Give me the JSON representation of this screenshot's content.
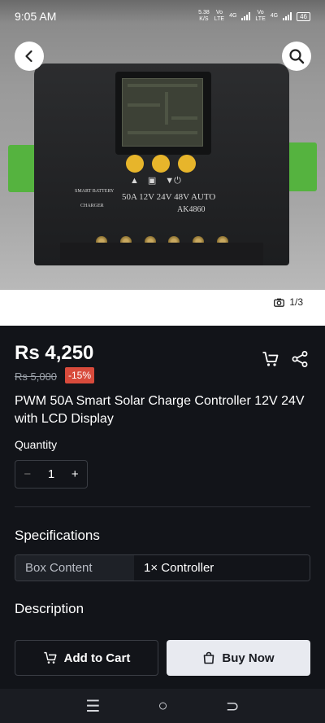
{
  "status_bar": {
    "time": "9:05 AM",
    "speed_value": "5.38",
    "speed_unit": "K/S",
    "sim1_top": "Vo",
    "sim1_bottom": "LTE",
    "sim1_net": "4G",
    "sim2_top": "Vo",
    "sim2_bottom": "LTE",
    "sim2_net": "4G",
    "battery": "46"
  },
  "product_image": {
    "device_label_left_1": "SMART BATTERY",
    "device_label_left_2": "CHARGER",
    "device_label_main": "50A 12V 24V 48V AUTO",
    "device_model": "AK4860",
    "counter": "1/3"
  },
  "product": {
    "price": "Rs 4,250",
    "original_price": "Rs 5,000",
    "discount_badge": "-15%",
    "title": "PWM 50A Smart Solar Charge Controller 12V 24V with LCD Display",
    "quantity_label": "Quantity",
    "quantity_value": "1",
    "minus_symbol": "−",
    "plus_symbol": "+"
  },
  "specifications": {
    "heading": "Specifications",
    "rows": [
      {
        "key": "Box Content",
        "value": "1× Controller"
      }
    ]
  },
  "description": {
    "heading": "Description"
  },
  "actions": {
    "add_to_cart": "Add to Cart",
    "buy_now": "Buy Now"
  },
  "system_nav": {
    "menu_glyph": "☰",
    "home_glyph": "○",
    "back_glyph": "⊃"
  },
  "colors": {
    "background": "#121419",
    "discount": "#d84b3c",
    "buy_button": "#e8eaf0",
    "accent_knobs": "#e7b52b"
  }
}
